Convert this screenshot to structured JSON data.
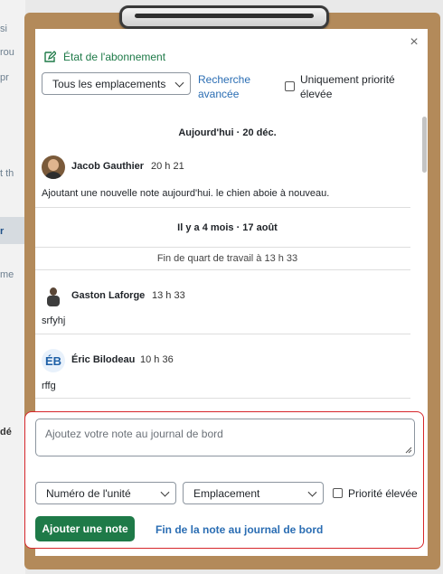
{
  "background": {
    "fragments": [
      "si",
      "rou",
      "pr",
      "t th",
      "r",
      "me",
      "dé"
    ]
  },
  "modal": {
    "subscription_status": "État de l'abonnement",
    "close_icon": "close-icon",
    "filters": {
      "location_select": "Tous les emplacements",
      "advanced_search": "Recherche avancée",
      "advanced_search_line1": "Recherche",
      "advanced_search_line2": "avancée",
      "priority_only_line1": "Uniquement priorité",
      "priority_only_line2": "élevée"
    },
    "feed": {
      "group1": {
        "heading": "Aujourd'hui · 20 déc.",
        "entries": [
          {
            "author": "Jacob Gauthier",
            "time": "20 h 21",
            "text": "Ajoutant une nouvelle note aujourd'hui. le chien aboie à nouveau.",
            "avatar": "photo"
          }
        ]
      },
      "group2": {
        "heading": "Il y a 4 mois · 17 août",
        "shift_end": "Fin de quart de travail à 13 h 33",
        "entries": [
          {
            "author": "Gaston Laforge",
            "time": "13 h 33",
            "text": "srfyhj",
            "avatar": "figure"
          },
          {
            "author": "Éric Bilodeau",
            "time": "10 h 36",
            "text": "rffg",
            "avatar_initials": "ÉB"
          }
        ]
      }
    },
    "composer": {
      "note_placeholder": "Ajoutez votre note au journal de bord",
      "unit_select": "Numéro de l'unité",
      "location_select": "Emplacement",
      "priority_label": "Priorité élevée",
      "add_button": "Ajouter une note",
      "end_link": "Fin de la note au journal de bord"
    }
  },
  "colors": {
    "accent_green": "#1e7a48",
    "link_blue": "#2a6db3",
    "highlight_red": "#d6262b",
    "clipboard_brown": "#b38a5a"
  }
}
